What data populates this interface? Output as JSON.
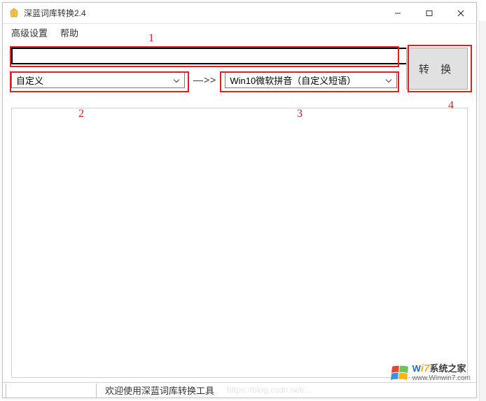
{
  "window": {
    "title": "深蓝词库转换2.4"
  },
  "menu": {
    "advanced": "高级设置",
    "help": "帮助"
  },
  "inputs": {
    "path_value": "",
    "browse_label": "...",
    "source_dd": "自定义",
    "target_dd": "Win10微软拼音（自定义短语）",
    "arrow": "—>>"
  },
  "buttons": {
    "convert": "转 换"
  },
  "status": {
    "text": "欢迎使用深蓝词库转换工具"
  },
  "annotations": {
    "l1": "1",
    "l2": "2",
    "l3": "3",
    "l4": "4"
  },
  "watermark": {
    "brand_prefix": "W",
    "brand_seven": "i7",
    "brand_suffix": "系统之家",
    "url": "www.Winwin7.com"
  },
  "faint_url": "https://blog.csdn.net/..."
}
